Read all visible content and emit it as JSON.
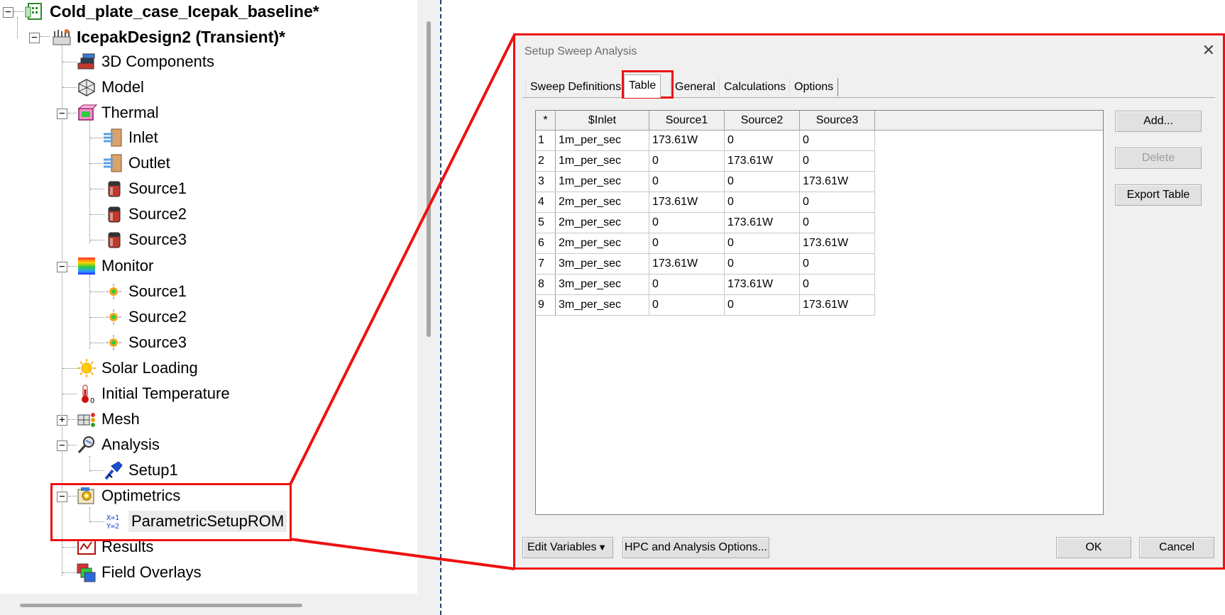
{
  "tree": {
    "root": "Cold_plate_case_Icepak_baseline*",
    "design": "IcepakDesign2 (Transient)*",
    "items": [
      "3D Components",
      "Model",
      "Thermal",
      "Inlet",
      "Outlet",
      "Source1",
      "Source2",
      "Source3",
      "Monitor",
      "Source1",
      "Source2",
      "Source3",
      "Solar Loading",
      "Initial Temperature",
      "Mesh",
      "Analysis",
      "Setup1",
      "Optimetrics",
      "ParametricSetupROM",
      "Results",
      "Field Overlays"
    ],
    "expander_minus": "−",
    "expander_plus": "+"
  },
  "dialog": {
    "title": "Setup Sweep Analysis",
    "close_glyph": "✕",
    "tabs": [
      "Sweep Definitions",
      "Table",
      "General",
      "Calculations",
      "Options"
    ],
    "active_tab": "Table",
    "table": {
      "columns": [
        "*",
        "$Inlet",
        "Source1",
        "Source2",
        "Source3"
      ],
      "rows": [
        [
          "1",
          "1m_per_sec",
          "173.61W",
          "0",
          "0"
        ],
        [
          "2",
          "1m_per_sec",
          "0",
          "173.61W",
          "0"
        ],
        [
          "3",
          "1m_per_sec",
          "0",
          "0",
          "173.61W"
        ],
        [
          "4",
          "2m_per_sec",
          "173.61W",
          "0",
          "0"
        ],
        [
          "5",
          "2m_per_sec",
          "0",
          "173.61W",
          "0"
        ],
        [
          "6",
          "2m_per_sec",
          "0",
          "0",
          "173.61W"
        ],
        [
          "7",
          "3m_per_sec",
          "173.61W",
          "0",
          "0"
        ],
        [
          "8",
          "3m_per_sec",
          "0",
          "173.61W",
          "0"
        ],
        [
          "9",
          "3m_per_sec",
          "0",
          "0",
          "173.61W"
        ]
      ]
    },
    "side_buttons": {
      "add": "Add...",
      "delete": "Delete",
      "export": "Export Table"
    },
    "bottom_buttons": {
      "edit_variables": "Edit Variables",
      "hpc": "HPC and Analysis Options...",
      "ok": "OK",
      "cancel": "Cancel"
    },
    "dropdown_glyph": "▼"
  },
  "colors": {
    "annotation_red": "#ee1111",
    "dialog_bg": "#f0f0f0"
  }
}
